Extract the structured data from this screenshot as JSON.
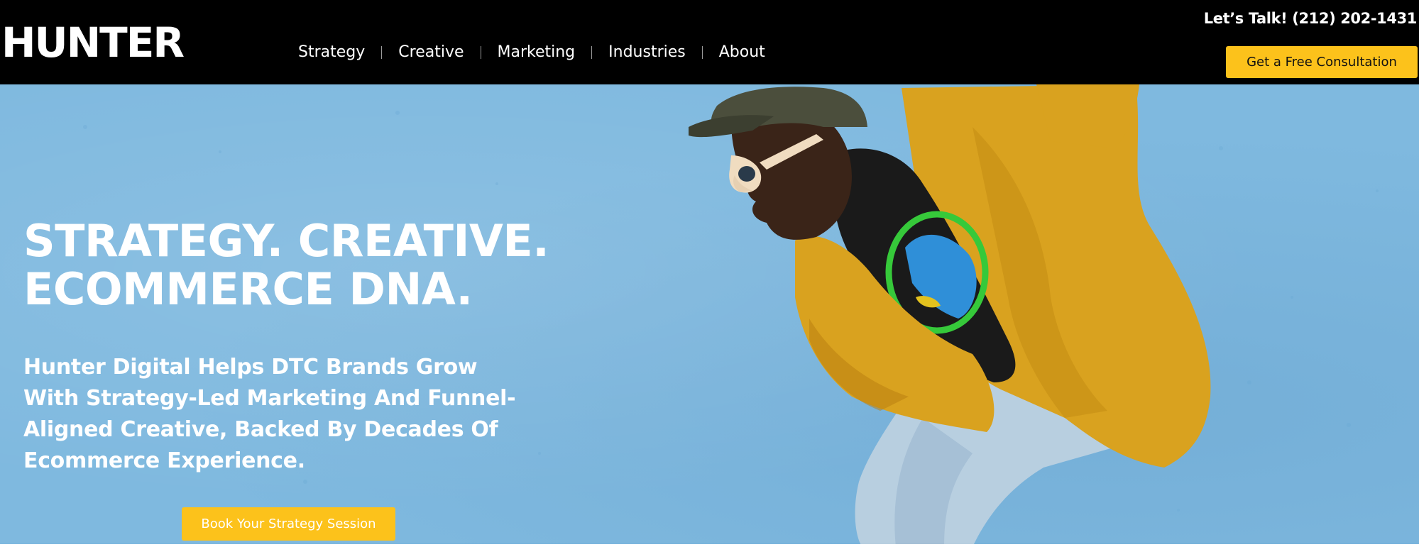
{
  "header": {
    "logo_text": "HUNTER",
    "phone_text": "Let’s Talk! (212) 202-1431",
    "cta_label": "Get a Free Consultation"
  },
  "nav": {
    "items": [
      {
        "label": "Strategy"
      },
      {
        "label": "Creative"
      },
      {
        "label": "Marketing"
      },
      {
        "label": "Industries"
      },
      {
        "label": "About"
      }
    ]
  },
  "hero": {
    "headline_lines": [
      "STRATEGY. CREATIVE.",
      "ECOMMERCE DNA."
    ],
    "subtext_lines": [
      "Hunter Digital Helps DTC Brands Grow",
      "With Strategy-Led Marketing And Funnel-",
      "Aligned Creative, Backed By Decades Of",
      "Ecommerce Experience."
    ],
    "cta_label": "Book Your Strategy Session"
  },
  "colors": {
    "header_bg": "#000000",
    "accent_yellow": "#fcc21b",
    "hero_blue": "#7fb9df",
    "jacket_mustard": "#d9a21f"
  }
}
